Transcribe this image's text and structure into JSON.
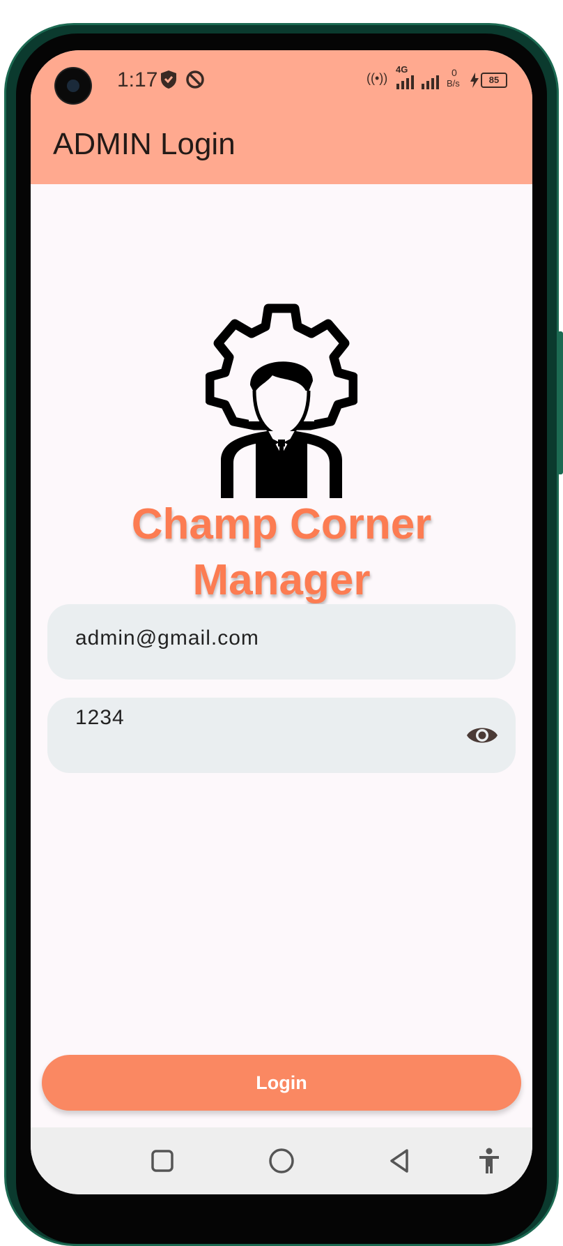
{
  "status_bar": {
    "time": "1:17",
    "hotspot": "((•))",
    "network": "4G",
    "net_speed_value": "0",
    "net_speed_unit": "B/s",
    "battery": "85",
    "icons": [
      "shield-icon",
      "dnd-icon",
      "hotspot-icon",
      "signal-icon",
      "signal-icon",
      "charging-icon",
      "battery-icon"
    ]
  },
  "appbar": {
    "title": "ADMIN Login",
    "color": "#ffa98f"
  },
  "logo": {
    "icon": "admin-gear-person-icon"
  },
  "app_name": {
    "line1": "Champ Corner",
    "line2": "Manager",
    "color": "#fc7c52"
  },
  "form": {
    "email_value": "admin@gmail.com",
    "password_value": "1234",
    "password_toggle_icon": "eye-icon"
  },
  "login_button": {
    "label": "Login",
    "color": "#fa8862"
  },
  "navbar": {
    "icons": [
      "square-icon",
      "circle-icon",
      "back-triangle-icon",
      "accessibility-icon"
    ]
  }
}
